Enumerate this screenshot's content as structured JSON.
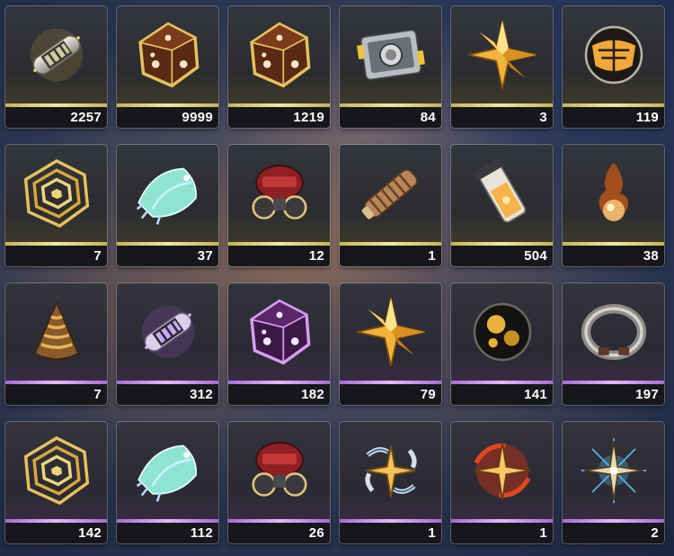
{
  "inventory": {
    "colors": {
      "gold_rarity": "#f4e79e",
      "purple_rarity": "#e7b6ff",
      "count_bg": "#16171a"
    },
    "items": [
      {
        "icon": "gold-capsule-icon",
        "rarity": "gold",
        "count": "2257"
      },
      {
        "icon": "gold-dice-core-icon",
        "rarity": "gold",
        "count": "9999"
      },
      {
        "icon": "gold-dice-core-icon",
        "rarity": "gold",
        "count": "1219"
      },
      {
        "icon": "device-module-icon",
        "rarity": "gold",
        "count": "84"
      },
      {
        "icon": "gold-star-shard-icon",
        "rarity": "gold",
        "count": "3"
      },
      {
        "icon": "gold-orb-icon",
        "rarity": "gold",
        "count": "119"
      },
      {
        "icon": "golden-spiral-web-icon",
        "rarity": "gold",
        "count": "7"
      },
      {
        "icon": "crystal-shell-icon",
        "rarity": "gold",
        "count": "37"
      },
      {
        "icon": "red-gas-mask-icon",
        "rarity": "gold",
        "count": "12"
      },
      {
        "icon": "bronze-cylinder-icon",
        "rarity": "gold",
        "count": "1"
      },
      {
        "icon": "liquid-vial-icon",
        "rarity": "gold",
        "count": "504"
      },
      {
        "icon": "flame-orb-icon",
        "rarity": "gold",
        "count": "38"
      },
      {
        "icon": "spiral-cone-icon",
        "rarity": "purple",
        "count": "7"
      },
      {
        "icon": "purple-capsule-icon",
        "rarity": "purple",
        "count": "312"
      },
      {
        "icon": "purple-dice-core-icon",
        "rarity": "purple",
        "count": "182"
      },
      {
        "icon": "gold-star-shard-icon",
        "rarity": "purple",
        "count": "79"
      },
      {
        "icon": "dark-gold-orb-icon",
        "rarity": "purple",
        "count": "141"
      },
      {
        "icon": "metal-ring-icon",
        "rarity": "purple",
        "count": "197"
      },
      {
        "icon": "golden-spiral-web-icon",
        "rarity": "purple",
        "count": "142"
      },
      {
        "icon": "crystal-shell-icon",
        "rarity": "purple",
        "count": "112"
      },
      {
        "icon": "red-gas-mask-icon",
        "rarity": "purple",
        "count": "26"
      },
      {
        "icon": "silver-star-burst-icon",
        "rarity": "purple",
        "count": "1"
      },
      {
        "icon": "red-star-burst-icon",
        "rarity": "purple",
        "count": "1"
      },
      {
        "icon": "blue-star-burst-icon",
        "rarity": "purple",
        "count": "2"
      }
    ]
  }
}
